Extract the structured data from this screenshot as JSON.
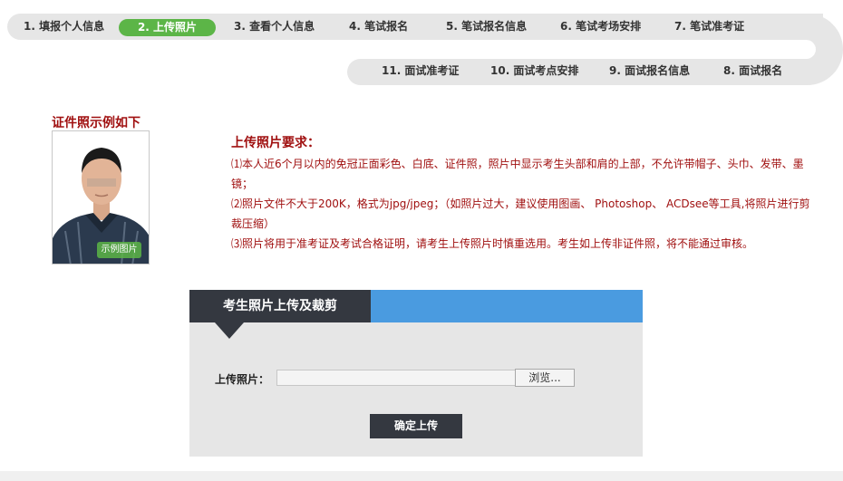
{
  "steps": [
    {
      "label": "1. 填报个人信息"
    },
    {
      "label": "2. 上传照片",
      "active": true
    },
    {
      "label": "3. 查看个人信息"
    },
    {
      "label": "4. 笔试报名"
    },
    {
      "label": "5. 笔试报名信息"
    },
    {
      "label": "6. 笔试考场安排"
    },
    {
      "label": "7. 笔试准考证"
    },
    {
      "label": "11. 面试准考证"
    },
    {
      "label": "10. 面试考点安排"
    },
    {
      "label": "9. 面试报名信息"
    },
    {
      "label": "8. 面试报名"
    }
  ],
  "sample": {
    "title": "证件照示例如下",
    "badge": "示例图片"
  },
  "requirements": {
    "title": "上传照片要求：",
    "items": [
      "⑴本人近6个月以内的免冠正面彩色、白底、证件照，照片中显示考生头部和肩的上部，不允许带帽子、头巾、发带、墨镜；",
      "⑵照片文件不大于200K，格式为jpg/jpeg；（如照片过大，建议使用图画、 Photoshop、 ACDsee等工具,将照片进行剪裁压缩）",
      "⑶照片将用于准考证及考试合格证明，请考生上传照片时慎重选用。考生如上传非证件照，将不能通过审核。"
    ]
  },
  "panel": {
    "title": "考生照片上传及裁剪",
    "upload_label": "上传照片：",
    "browse_label": "浏览...",
    "confirm_label": "确定上传"
  },
  "colors": {
    "active_step": "#5cb547",
    "accent_red": "#a01010",
    "panel_blue": "#4a9be0",
    "panel_dark": "#343840"
  }
}
